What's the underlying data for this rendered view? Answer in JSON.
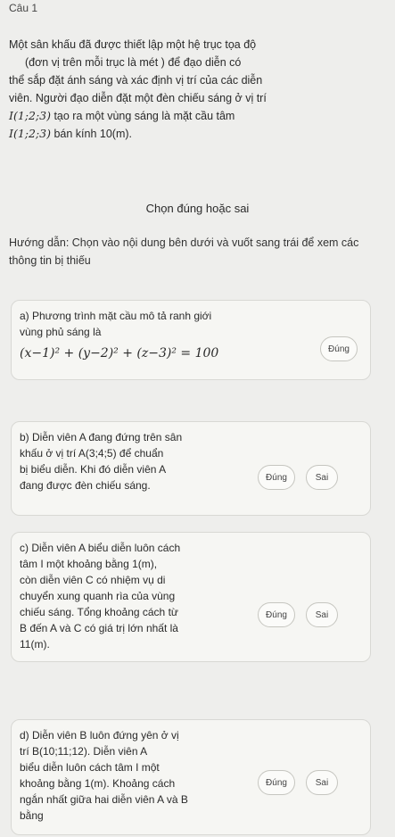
{
  "question": {
    "number": "Câu 1",
    "intro_lines": [
      "Một sân khấu đã được thiết lập một hệ trục tọa độ",
      "(đơn vị trên mỗi trục là mét ) để đạo diễn có",
      "thể sắp đặt ánh sáng và xác định vị trí của các diễn",
      "viên. Người đạo diễn đặt một đèn chiếu sáng ở vị trí"
    ],
    "intro_math1": "I(1;2;3)",
    "intro_after1": " tạo ra một vùng sáng là mặt cầu tâm",
    "intro_math2": "I(1;2;3)",
    "intro_after2": " bán kính 10(m)."
  },
  "choose_label": "Chọn đúng hoặc sai",
  "guide_text": "Hướng dẫn: Chọn vào nội dung bên dưới và vuốt sang trái để xem các thông tin bị thiếu",
  "statements": [
    {
      "text_lines": [
        "a) Phương trình mặt cầu mô tả ranh giới",
        "vùng phủ sáng là"
      ],
      "math": "(x−1)² + (y−2)² + (z−3)² = 100",
      "options": [
        "Đúng"
      ]
    },
    {
      "text_lines": [
        "b) Diễn viên A đang đứng trên sân",
        "khấu ở vị trí A(3;4;5) để chuẩn",
        "bị biểu diễn. Khi đó diễn viên A",
        "đang được đèn chiếu sáng."
      ],
      "options": [
        "Đúng",
        "Sai"
      ]
    },
    {
      "text_lines": [
        "c) Diễn viên A biểu diễn luôn cách",
        "tâm I một khoảng bằng 1(m),",
        "còn diễn viên C có nhiệm vụ di",
        "chuyển xung quanh rìa của vùng",
        "chiếu sáng. Tổng khoảng cách từ",
        "B đến A và C có giá trị lớn nhất là",
        "11(m)."
      ],
      "options": [
        "Đúng",
        "Sai"
      ]
    },
    {
      "text_lines": [
        "d) Diễn viên B luôn đứng yên ở vị",
        "trí B(10;11;12). Diễn viên A",
        "biểu diễn luôn cách tâm I một",
        "khoảng bằng 1(m). Khoảng cách",
        "ngắn nhất giữa hai diễn viên A và B",
        "bằng"
      ],
      "options": [
        "Đúng",
        "Sai"
      ]
    }
  ]
}
